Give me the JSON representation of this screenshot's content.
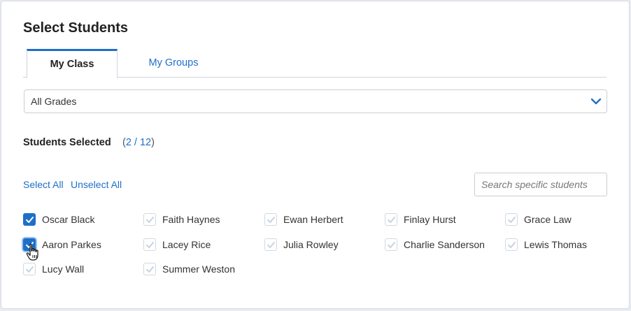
{
  "title": "Select Students",
  "tabs": [
    {
      "label": "My Class",
      "active": true
    },
    {
      "label": "My Groups",
      "active": false
    }
  ],
  "grade_select": {
    "value": "All Grades"
  },
  "students_selected": {
    "label": "Students Selected",
    "open": "(",
    "count": "2 / 12",
    "close": ")"
  },
  "actions": {
    "select_all": "Select All",
    "unselect_all": "Unselect All"
  },
  "search": {
    "placeholder": "Search specific students"
  },
  "colors": {
    "accent": "#1e6fc8",
    "check_inactive": "#c6d3e3"
  },
  "students": [
    {
      "name": "Oscar Black",
      "checked": true
    },
    {
      "name": "Faith Haynes",
      "checked": false
    },
    {
      "name": "Ewan Herbert",
      "checked": false
    },
    {
      "name": "Finlay Hurst",
      "checked": false
    },
    {
      "name": "Grace Law",
      "checked": false
    },
    {
      "name": "Aaron Parkes",
      "checked": true
    },
    {
      "name": "Lacey Rice",
      "checked": false
    },
    {
      "name": "Julia Rowley",
      "checked": false
    },
    {
      "name": "Charlie Sanderson",
      "checked": false
    },
    {
      "name": "Lewis Thomas",
      "checked": false
    },
    {
      "name": "Lucy Wall",
      "checked": false
    },
    {
      "name": "Summer Weston",
      "checked": false
    }
  ]
}
